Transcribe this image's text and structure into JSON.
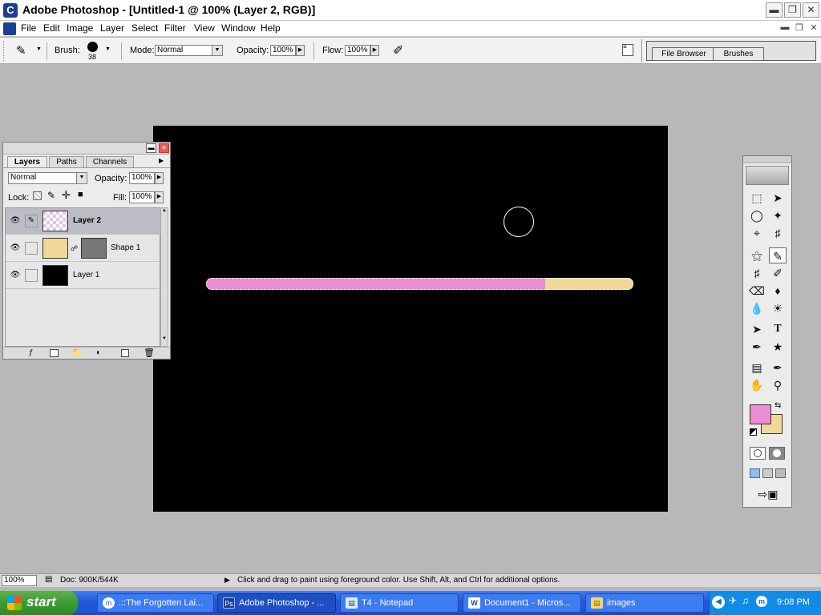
{
  "window": {
    "title": "Adobe Photoshop - [Untitled-1 @ 100% (Layer 2, RGB)]",
    "app_icon": "photoshop-icon",
    "app_icon_letter": "C"
  },
  "menu": [
    "File",
    "Edit",
    "Image",
    "Layer",
    "Select",
    "Filter",
    "View",
    "Window",
    "Help"
  ],
  "options": {
    "brush_label": "Brush:",
    "brush_size": "38",
    "mode_label": "Mode:",
    "mode_value": "Normal",
    "opacity_label": "Opacity:",
    "opacity_value": "100%",
    "flow_label": "Flow:",
    "flow_value": "100%",
    "well_tabs": [
      "File Browser",
      "Brushes"
    ]
  },
  "layers_palette": {
    "tabs": [
      "Layers",
      "Paths",
      "Channels"
    ],
    "blend_mode": "Normal",
    "opacity_label": "Opacity:",
    "opacity_value": "100%",
    "lock_label": "Lock:",
    "fill_label": "Fill:",
    "fill_value": "100%",
    "layers": [
      {
        "name": "Layer 2",
        "selected": true
      },
      {
        "name": "Shape 1",
        "selected": false
      },
      {
        "name": "Layer 1",
        "selected": false
      }
    ]
  },
  "canvas": {
    "background_color": "#000000",
    "stroke_colors": [
      "#e98ed2",
      "#f0d898"
    ]
  },
  "toolbox": {
    "foreground_color": "#e98ed2",
    "background_color": "#f0d898"
  },
  "status": {
    "zoom": "100%",
    "doc": "Doc: 900K/544K",
    "hint": "Click and drag to paint using foreground color.  Use Shift, Alt, and Ctrl for additional options."
  },
  "taskbar": {
    "start_label": "start",
    "tasks": [
      {
        "label": ".::The Forgotten Lai...",
        "icon": "messenger-icon",
        "active": false
      },
      {
        "label": "Adobe Photoshop - ...",
        "icon": "photoshop-icon",
        "active": true
      },
      {
        "label": "T4 - Notepad",
        "icon": "notepad-icon",
        "active": false
      },
      {
        "label": "Document1 - Micros...",
        "icon": "word-icon",
        "active": false
      },
      {
        "label": "images",
        "icon": "folder-icon",
        "active": false
      }
    ],
    "clock": "9:08 PM"
  }
}
